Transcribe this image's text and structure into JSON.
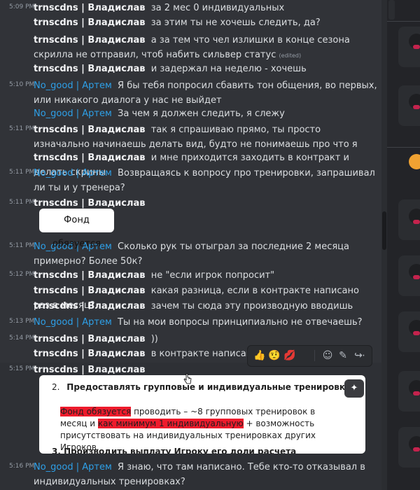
{
  "messages": [
    {
      "time": "5:09 PM",
      "author": "trnscdns | Владислав",
      "author_type": "white",
      "text": "за 2 мес 0 индивидуальных"
    },
    {
      "time": "",
      "author": "trnscdns | Владислав",
      "author_type": "white",
      "text": "за этим ты не хочешь следить, да?"
    },
    {
      "time": "",
      "author": "trnscdns | Владислав",
      "author_type": "white",
      "text": "а за тем что чел излишки в конце сезона скрилла не отправил, чтоб набить сильвер статус",
      "edited": "(edited)"
    },
    {
      "time": "",
      "author": "trnscdns | Владислав",
      "author_type": "white",
      "text": "и задержал на неделю - хочешь"
    },
    {
      "time": "5:10 PM",
      "author": "No_good | Артем",
      "author_type": "blue",
      "text": "Я бы тебя попросил сбавить тон общения, во первых, или никакого диалога у нас не выйдет"
    },
    {
      "time": "",
      "author": "No_good | Артем",
      "author_type": "blue",
      "text": "За чем я должен следить, я слежу"
    },
    {
      "time": "5:11 PM",
      "author": "trnscdns | Владислав",
      "author_type": "white",
      "text": "так я спрашиваю прямо, ты просто изначально начинаешь делать вид, будто не понимаешь про что я"
    },
    {
      "time": "",
      "author": "trnscdns | Владислав",
      "author_type": "white",
      "text": "и мне приходится заходить в контракт и делать скрины"
    },
    {
      "time": "5:11 PM",
      "author": "No_good | Артем",
      "author_type": "blue",
      "text": "Возвращаясь к вопросу про тренировки, запрашивал ли ты и у тренера?"
    },
    {
      "time": "5:11 PM",
      "author": "trnscdns | Владислав",
      "author_type": "white",
      "text": ""
    },
    {
      "time": "5:11 PM",
      "author": "No_good | Артем",
      "author_type": "blue",
      "text": "Сколько рук ты отыграл за последние 2 месяца примерно? Более 50к?"
    },
    {
      "time": "5:12 PM",
      "author": "trnscdns | Владислав",
      "author_type": "white",
      "text": "не \"если игрок попросит\""
    },
    {
      "time": "",
      "author": "trnscdns | Владислав",
      "author_type": "white",
      "text": "какая разница, если в контракте написано раз в месяц?"
    },
    {
      "time": "",
      "author": "trnscdns | Владислав",
      "author_type": "white",
      "text": "зачем ты сюда эту производную вводишь"
    },
    {
      "time": "5:13 PM",
      "author": "No_good | Артем",
      "author_type": "blue",
      "text": "Ты на мои вопросы принципиально не отвечаешь?"
    },
    {
      "time": "5:14 PM",
      "author": "trnscdns | Владислав",
      "author_type": "white",
      "text": "))"
    },
    {
      "time": "",
      "author": "trnscdns | Владислав",
      "author_type": "white",
      "text": "в контракте написано:"
    },
    {
      "time": "5:15 PM",
      "author": "trnscdns | Владислав",
      "author_type": "white",
      "text": ""
    },
    {
      "time": "5:16 PM",
      "author": "No_good | Артем",
      "author_type": "blue",
      "text": "Я знаю, что там написано. Тебе кто-то отказывал в индивидуальных тренировках?"
    }
  ],
  "image_attachment": {
    "text": "Фонд обязуется"
  },
  "contract_embed": {
    "item2_label": "2.",
    "item2_title": "Предоставлять групповые и индивидуальные тренировки",
    "hl1": "Фонд обязуется",
    "plain1": " проводить – ~8 групповых тренировок в месяц и ",
    "hl2": "как минимум 1 индивидуальную",
    "plain2": " + возможность присутствовать на индивидуальных тренировках других Игроков.",
    "item3": "3.  Производить выплату Игроку его доли расчета"
  },
  "reaction_toolbar": [
    {
      "name": "thumbs-up-reaction-icon",
      "glyph": "👍"
    },
    {
      "name": "face-reaction-icon",
      "glyph": "🤨"
    },
    {
      "name": "lips-reaction-icon",
      "glyph": "💋"
    },
    {
      "name": "add-reaction-icon",
      "glyph": "☺"
    },
    {
      "name": "edit-icon",
      "glyph": "✎"
    },
    {
      "name": "forward-icon",
      "glyph": "↪"
    },
    {
      "name": "more-icon",
      "glyph": "⋯"
    }
  ],
  "colors": {
    "background": "#313338",
    "author_blue": "#2ea0e8",
    "highlight_red": "#ee1b2c",
    "sidebar": "#232428"
  }
}
